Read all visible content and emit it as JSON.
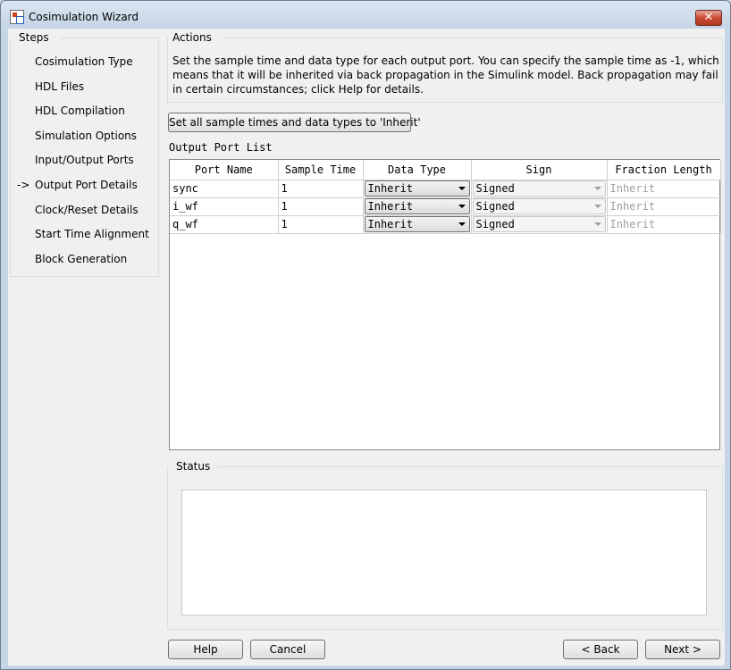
{
  "window": {
    "title": "Cosimulation Wizard",
    "close_glyph": "✕"
  },
  "steps": {
    "label": "Steps",
    "current_marker": "->",
    "items": [
      {
        "label": "Cosimulation Type",
        "current": false
      },
      {
        "label": "HDL Files",
        "current": false
      },
      {
        "label": "HDL Compilation",
        "current": false
      },
      {
        "label": "Simulation Options",
        "current": false
      },
      {
        "label": "Input/Output Ports",
        "current": false
      },
      {
        "label": "Output Port Details",
        "current": true
      },
      {
        "label": "Clock/Reset Details",
        "current": false
      },
      {
        "label": "Start Time Alignment",
        "current": false
      },
      {
        "label": "Block Generation",
        "current": false
      }
    ]
  },
  "actions": {
    "label": "Actions",
    "description": "Set the sample time and data type for each output port. You can specify the sample time as -1, which means that it will be inherited via back propagation in the Simulink model. Back propagation may fail in certain circumstances; click Help for details.",
    "set_all_button": "Set all sample times and data types to 'Inherit'"
  },
  "port_list": {
    "label": "Output Port List",
    "columns": [
      "Port Name",
      "Sample Time",
      "Data Type",
      "Sign",
      "Fraction Length"
    ],
    "rows": [
      {
        "name": "sync",
        "sample_time": "1",
        "data_type": "Inherit",
        "sign": "Signed",
        "fraction_length": "Inherit"
      },
      {
        "name": "i_wf",
        "sample_time": "1",
        "data_type": "Inherit",
        "sign": "Signed",
        "fraction_length": "Inherit"
      },
      {
        "name": "q_wf",
        "sample_time": "1",
        "data_type": "Inherit",
        "sign": "Signed",
        "fraction_length": "Inherit"
      }
    ]
  },
  "status": {
    "label": "Status",
    "text": ""
  },
  "footer": {
    "help": "Help",
    "cancel": "Cancel",
    "back": "< Back",
    "next": "Next >"
  }
}
